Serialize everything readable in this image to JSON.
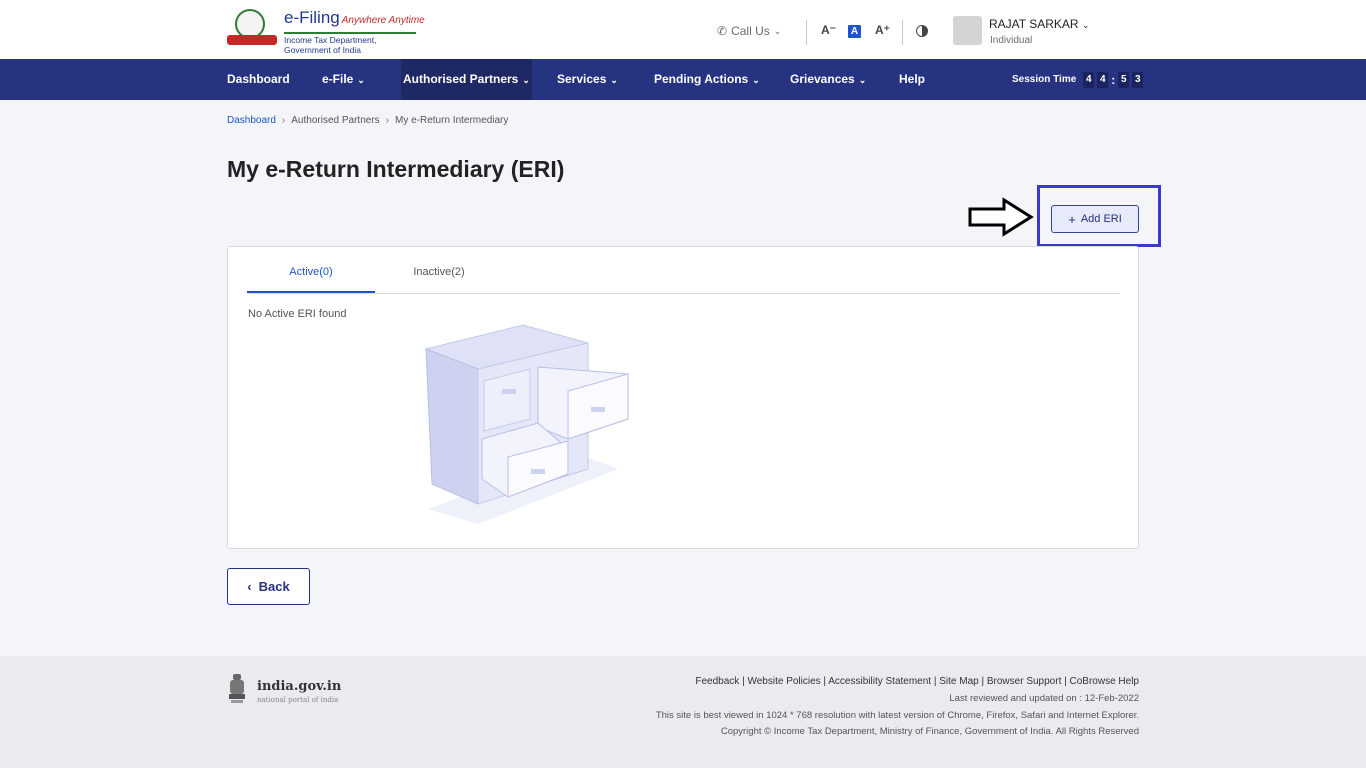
{
  "header": {
    "logo_title": "e-Filing",
    "logo_tagline": "Anywhere Anytime",
    "logo_subtitle": "Income Tax Department, Government of India",
    "call_us": "Call Us",
    "font_smaller": "A⁻",
    "font_default": "A",
    "font_larger": "A⁺",
    "user_name": "RAJAT SARKAR",
    "user_role": "Individual"
  },
  "nav": {
    "items": [
      {
        "label": "Dashboard"
      },
      {
        "label": "e-File"
      },
      {
        "label": "Authorised Partners"
      },
      {
        "label": "Services"
      },
      {
        "label": "Pending Actions"
      },
      {
        "label": "Grievances"
      },
      {
        "label": "Help"
      }
    ],
    "session_label": "Session Time",
    "session_digits": [
      "4",
      "4",
      "5",
      "3"
    ]
  },
  "breadcrumb": [
    "Dashboard",
    "Authorised Partners",
    "My e-Return Intermediary"
  ],
  "page_title": "My e-Return Intermediary (ERI)",
  "add_button": "Add ERI",
  "tabs": [
    {
      "label": "Active(0)",
      "active": true
    },
    {
      "label": "Inactive(2)",
      "active": false
    }
  ],
  "empty_message": "No Active ERI found",
  "back_button": "Back",
  "footer": {
    "brand": "india.gov.in",
    "brand_sub": "national portal of india",
    "links": [
      "Feedback",
      "Website Policies",
      "Accessibility Statement",
      "Site Map",
      "Browser Support",
      "CoBrowse Help"
    ],
    "last_reviewed": "Last reviewed and updated on : 12-Feb-2022",
    "best_viewed": "This site is best viewed in 1024 * 768 resolution with latest version of Chrome, Firefox, Safari and Internet Explorer.",
    "copyright": "Copyright © Income Tax Department, Ministry of Finance, Government of India. All Rights Reserved"
  },
  "colors": {
    "nav_bg": "#263380",
    "link_blue": "#1e55c8",
    "highlight_border": "#3a3ac8"
  }
}
